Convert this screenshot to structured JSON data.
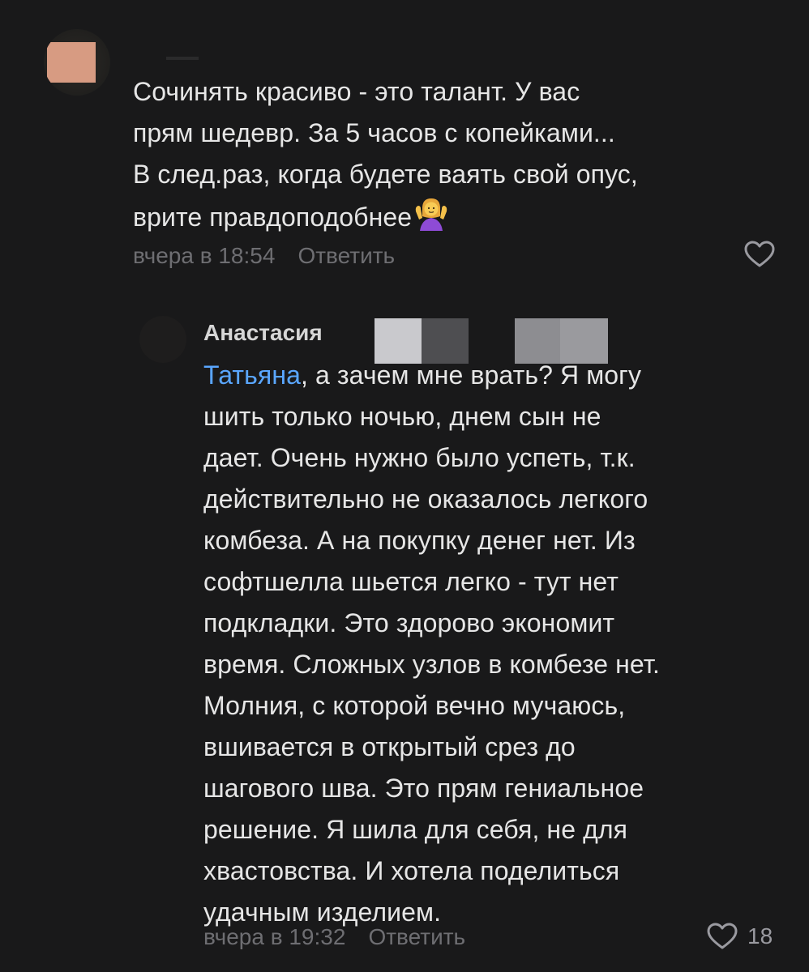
{
  "comment1": {
    "lines": [
      "Сочинять красиво - это талант. У вас",
      "прям шедевр. За 5 часов с копейками...",
      "В след.раз, когда будете ваять свой опус,",
      "врите правдоподобнее"
    ],
    "emoji": "person-shrugging-emoji",
    "time": "вчера в 18:54",
    "reply_label": "Ответить",
    "like_icon": "heart-icon"
  },
  "comment2": {
    "author": "Анастасия",
    "mention": "Татьяна",
    "first_line_rest": ", а зачем мне врать? Я могу",
    "lines": [
      "шить только ночью, днем сын не",
      "дает. Очень нужно было успеть, т.к.",
      "действительно не оказалось легкого",
      "комбеза. А на покупку денег нет. Из",
      "софтшелла шьется легко - тут нет",
      "подкладки. Это здорово экономит",
      "время. Сложных узлов в комбезе нет.",
      "Молния, с которой вечно мучаюсь,",
      "вшивается в открытый срез до",
      "шагового шва. Это прям гениальное",
      "решение. Я шила для себя, не для",
      "хвастовства. И хотела поделиться",
      "удачным изделием."
    ],
    "time": "вчера в 19:32",
    "reply_label": "Ответить",
    "like_icon": "heart-icon",
    "like_count": "18"
  },
  "colors": {
    "background": "#19191a",
    "text": "#e6e6e6",
    "meta": "#6e6e72",
    "mention": "#5aa6ff"
  }
}
